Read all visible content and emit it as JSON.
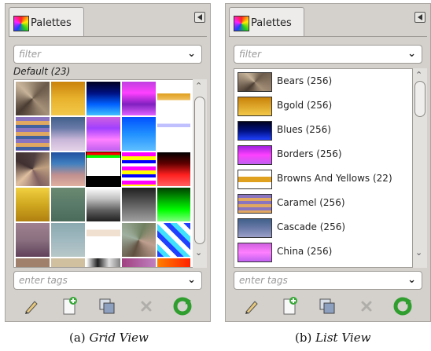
{
  "panels": [
    {
      "id": "grid",
      "tab_label": "Palettes",
      "filter_placeholder": "filter",
      "section_label": "Default (23)",
      "tags_placeholder": "enter tags",
      "caption_prefix": "(a)",
      "caption_title": "Grid View"
    },
    {
      "id": "list",
      "tab_label": "Palettes",
      "filter_placeholder": "filter",
      "tags_placeholder": "enter tags",
      "caption_prefix": "(b)",
      "caption_title": "List View",
      "items": [
        {
          "label": "Bears (256)"
        },
        {
          "label": "Bgold (256)"
        },
        {
          "label": "Blues (256)"
        },
        {
          "label": "Borders (256)"
        },
        {
          "label": "Browns And Yellows (22)"
        },
        {
          "label": "Caramel (256)"
        },
        {
          "label": "Cascade (256)"
        },
        {
          "label": "China (256)"
        }
      ]
    }
  ],
  "footer_buttons": [
    "edit-palette",
    "new-palette",
    "duplicate-palette",
    "delete-palette",
    "refresh-palettes"
  ],
  "colors": {
    "panel_bg": "#d4d1cc",
    "refresh_green": "#2f9e2f"
  }
}
